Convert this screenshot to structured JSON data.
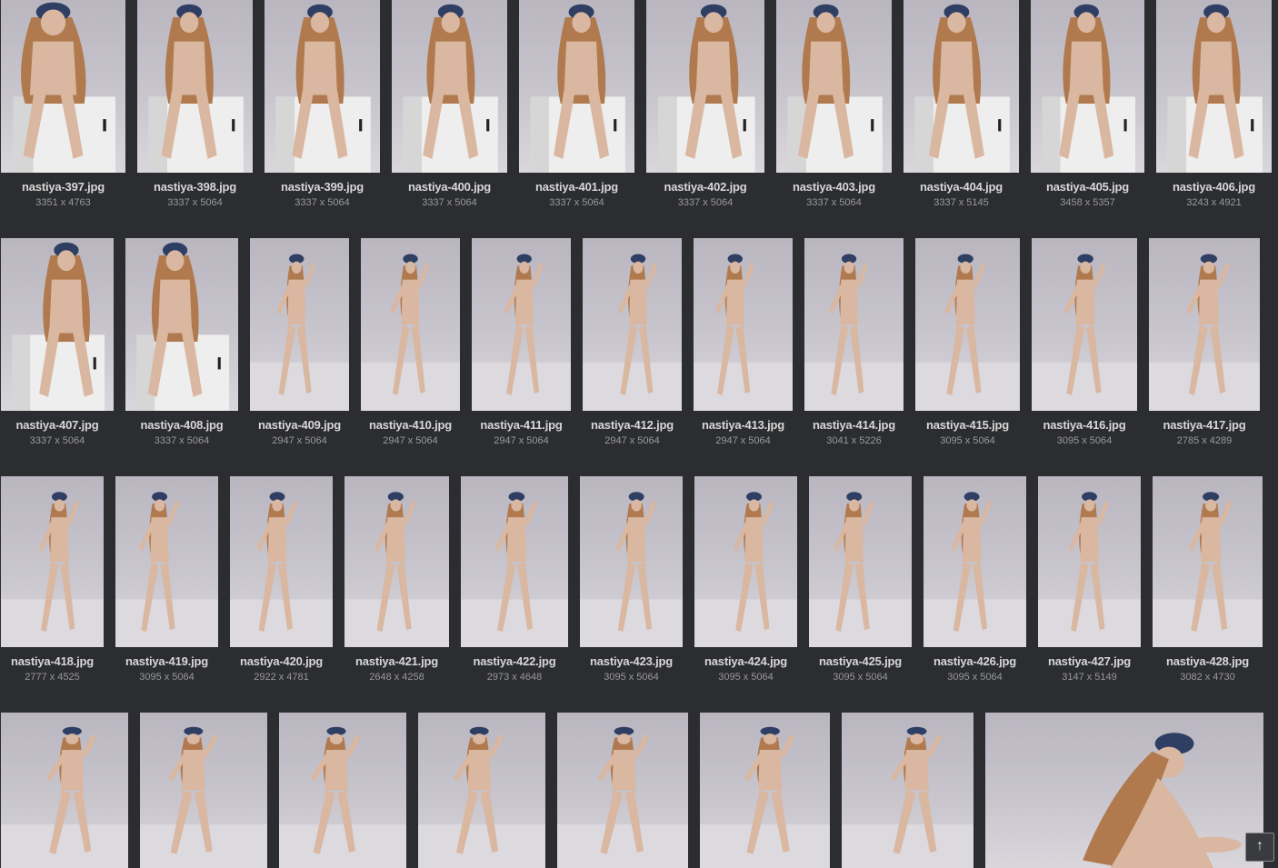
{
  "gallery": {
    "rows": [
      [
        {
          "file": "nastiya-397.jpg",
          "dims": "3351 x 4763",
          "pose": "sit-close"
        },
        {
          "file": "nastiya-398.jpg",
          "dims": "3337 x 5064",
          "pose": "sit"
        },
        {
          "file": "nastiya-399.jpg",
          "dims": "3337 x 5064",
          "pose": "sit"
        },
        {
          "file": "nastiya-400.jpg",
          "dims": "3337 x 5064",
          "pose": "sit"
        },
        {
          "file": "nastiya-401.jpg",
          "dims": "3337 x 5064",
          "pose": "sit"
        },
        {
          "file": "nastiya-402.jpg",
          "dims": "3337 x 5064",
          "pose": "sit"
        },
        {
          "file": "nastiya-403.jpg",
          "dims": "3337 x 5064",
          "pose": "sit"
        },
        {
          "file": "nastiya-404.jpg",
          "dims": "3337 x 5145",
          "pose": "sit"
        },
        {
          "file": "nastiya-405.jpg",
          "dims": "3458 x 5357",
          "pose": "sit"
        },
        {
          "file": "nastiya-406.jpg",
          "dims": "3243 x 4921",
          "pose": "sit"
        }
      ],
      [
        {
          "file": "nastiya-407.jpg",
          "dims": "3337 x 5064",
          "pose": "sit"
        },
        {
          "file": "nastiya-408.jpg",
          "dims": "3337 x 5064",
          "pose": "sit"
        },
        {
          "file": "nastiya-409.jpg",
          "dims": "2947 x 5064",
          "pose": "stand"
        },
        {
          "file": "nastiya-410.jpg",
          "dims": "2947 x 5064",
          "pose": "stand"
        },
        {
          "file": "nastiya-411.jpg",
          "dims": "2947 x 5064",
          "pose": "stand"
        },
        {
          "file": "nastiya-412.jpg",
          "dims": "2947 x 5064",
          "pose": "stand"
        },
        {
          "file": "nastiya-413.jpg",
          "dims": "2947 x 5064",
          "pose": "stand"
        },
        {
          "file": "nastiya-414.jpg",
          "dims": "3041 x 5226",
          "pose": "stand"
        },
        {
          "file": "nastiya-415.jpg",
          "dims": "3095 x 5064",
          "pose": "stand"
        },
        {
          "file": "nastiya-416.jpg",
          "dims": "3095 x 5064",
          "pose": "stand"
        },
        {
          "file": "nastiya-417.jpg",
          "dims": "2785 x 4289",
          "pose": "stand"
        }
      ],
      [
        {
          "file": "nastiya-418.jpg",
          "dims": "2777 x 4525",
          "pose": "stand"
        },
        {
          "file": "nastiya-419.jpg",
          "dims": "3095 x 5064",
          "pose": "stand"
        },
        {
          "file": "nastiya-420.jpg",
          "dims": "2922 x 4781",
          "pose": "stand"
        },
        {
          "file": "nastiya-421.jpg",
          "dims": "2648 x 4258",
          "pose": "stand"
        },
        {
          "file": "nastiya-422.jpg",
          "dims": "2973 x 4648",
          "pose": "stand"
        },
        {
          "file": "nastiya-423.jpg",
          "dims": "3095 x 5064",
          "pose": "stand"
        },
        {
          "file": "nastiya-424.jpg",
          "dims": "3095 x 5064",
          "pose": "stand"
        },
        {
          "file": "nastiya-425.jpg",
          "dims": "3095 x 5064",
          "pose": "stand"
        },
        {
          "file": "nastiya-426.jpg",
          "dims": "3095 x 5064",
          "pose": "stand"
        },
        {
          "file": "nastiya-427.jpg",
          "dims": "3147 x 5149",
          "pose": "stand"
        },
        {
          "file": "nastiya-428.jpg",
          "dims": "3082 x 4730",
          "pose": "stand"
        }
      ],
      [
        {
          "file": "",
          "dims": "",
          "pose": "stand"
        },
        {
          "file": "",
          "dims": "",
          "pose": "stand"
        },
        {
          "file": "",
          "dims": "",
          "pose": "stand"
        },
        {
          "file": "",
          "dims": "",
          "pose": "stand"
        },
        {
          "file": "",
          "dims": "",
          "pose": "stand"
        },
        {
          "file": "",
          "dims": "",
          "pose": "stand"
        },
        {
          "file": "",
          "dims": "",
          "pose": "stand"
        },
        {
          "file": "",
          "dims": "",
          "pose": "crouch"
        }
      ]
    ],
    "colors": {
      "background": "#2c2d30",
      "filename": "#d7d7d7",
      "dimensions": "#9a9a9a",
      "skin": "#d9b7a0",
      "hair": "#b07a4e",
      "cap": "#2f3f63"
    }
  },
  "scroll_top": {
    "icon": "arrow-up-icon",
    "label": "↑"
  }
}
